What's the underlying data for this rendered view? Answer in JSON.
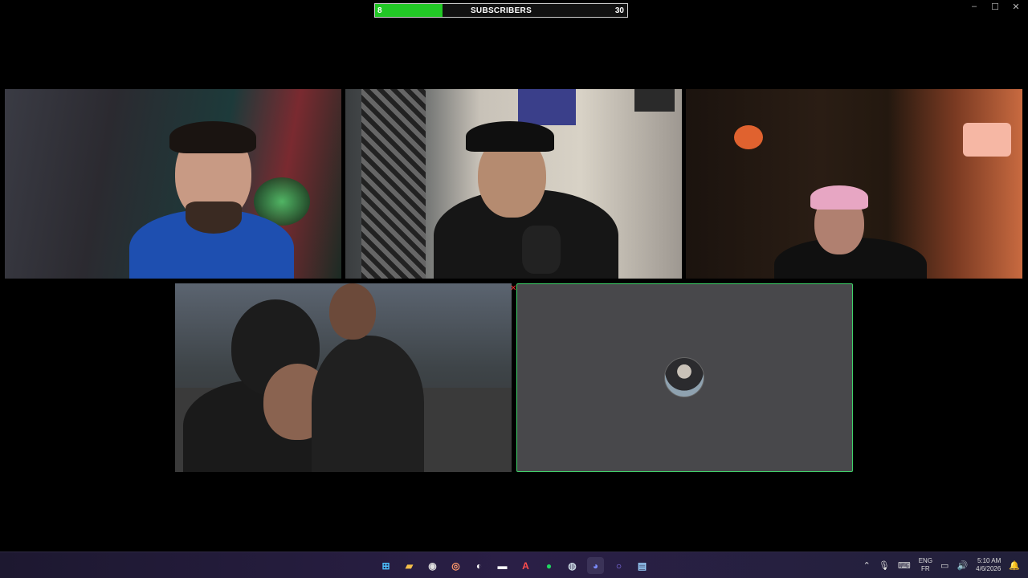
{
  "window": {
    "minimize": "–",
    "maximize": "☐",
    "close": "✕"
  },
  "subscribers": {
    "current": "8",
    "label": "SUBSCRIBERS",
    "goal": "30",
    "progress": 0.267,
    "fill_color": "#22c826"
  },
  "tiles": [
    {
      "participant_type": "webcam"
    },
    {
      "participant_type": "webcam"
    },
    {
      "participant_type": "webcam"
    },
    {
      "participant_type": "game-stream"
    },
    {
      "participant_type": "avatar-only",
      "highlight_color": "#3fd36a"
    }
  ],
  "taskbar": {
    "icons": [
      {
        "name": "start-icon",
        "glyph": "⊞",
        "color": "#4cc2ff"
      },
      {
        "name": "file-explorer-icon",
        "glyph": "▰",
        "color": "#f5c04a"
      },
      {
        "name": "chrome-icon",
        "glyph": "◉",
        "color": "#e0e0e0"
      },
      {
        "name": "app-swirl-icon",
        "glyph": "◎",
        "color": "#ff9a6b"
      },
      {
        "name": "obs-icon",
        "glyph": "◐",
        "color": "#ffffff"
      },
      {
        "name": "capcut-icon",
        "glyph": "▬",
        "color": "#ffffff"
      },
      {
        "name": "adobe-icon",
        "glyph": "A",
        "color": "#ff4d4d"
      },
      {
        "name": "spotify-icon",
        "glyph": "●",
        "color": "#1ed760"
      },
      {
        "name": "steam-icon",
        "glyph": "◍",
        "color": "#c7d5e0"
      },
      {
        "name": "discord-icon",
        "glyph": "◕",
        "color": "#7b8cff"
      },
      {
        "name": "circle-app-icon",
        "glyph": "○",
        "color": "#8a7aff"
      },
      {
        "name": "notepad-icon",
        "glyph": "▤",
        "color": "#9bd2ff"
      }
    ],
    "tray": {
      "lang_top": "ENG",
      "lang_bottom": "FR",
      "time": "5:10 AM",
      "date": "4/6/2026"
    }
  }
}
